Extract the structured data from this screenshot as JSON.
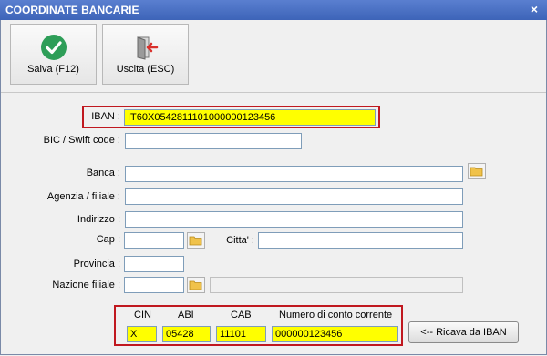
{
  "window": {
    "title": "COORDINATE BANCARIE",
    "close_glyph": "×"
  },
  "toolbar": {
    "save_label": "Salva (F12)",
    "exit_label": "Uscita (ESC)"
  },
  "form": {
    "iban_label": "IBAN :",
    "iban_value": "IT60X0542811101000000123456",
    "bic_label": "BIC / Swift code :",
    "bic_value": "",
    "banca_label": "Banca :",
    "banca_value": "",
    "agenzia_label": "Agenzia / filiale :",
    "agenzia_value": "",
    "indirizzo_label": "Indirizzo :",
    "indirizzo_value": "",
    "cap_label": "Cap :",
    "cap_value": "",
    "citta_label": "Citta' :",
    "citta_value": "",
    "provincia_label": "Provincia :",
    "provincia_value": "",
    "nazione_label": "Nazione filiale :",
    "nazione_code": "",
    "nazione_name": ""
  },
  "bank_coords": {
    "cin_label": "CIN",
    "cin_value": "X",
    "abi_label": "ABI",
    "abi_value": "05428",
    "cab_label": "CAB",
    "cab_value": "11101",
    "conto_label": "Numero di conto corrente",
    "conto_value": "000000123456"
  },
  "ricava_button": "<-- Ricava da IBAN",
  "colors": {
    "highlight": "#ffff00",
    "accent_box": "#c0181f",
    "save_icon": "#2e9e58",
    "exit_arrow": "#d9302b"
  }
}
